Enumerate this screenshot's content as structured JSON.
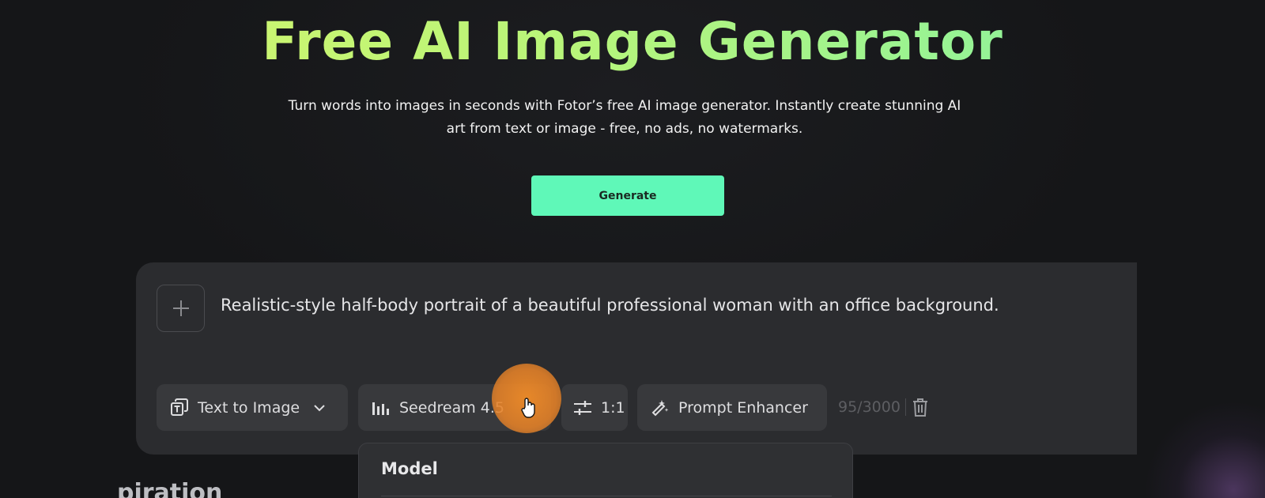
{
  "hero": {
    "title": "Free AI Image Generator",
    "subtitle_line1": "Turn words into images in seconds with Fotor’s free AI image generator. Instantly create stunning AI",
    "subtitle_line2": "art from text or image - free, no ads, no watermarks.",
    "generate_label": "Generate"
  },
  "prompt": {
    "text": "Realistic-style half-body portrait of a beautiful professional woman with an office background."
  },
  "toolbar": {
    "mode_label": "Text to Image",
    "model_label": "Seedream 4.5",
    "ratio_label": "1:1",
    "enhancer_label": "Prompt Enhancer",
    "counter": "95/3000"
  },
  "dropdown": {
    "title": "Model"
  },
  "section": {
    "partial_heading": "piration"
  },
  "colors": {
    "accent": "#5ff8b8",
    "title_gradient_start": "#d8f56a",
    "title_gradient_end": "#7ff2a8",
    "cursor_halo": "#f08c28"
  },
  "icons": {
    "add": "plus-icon",
    "mode": "text-image-icon",
    "mode_chevron": "chevron-down-icon",
    "model": "bars-icon",
    "ratio": "sliders-icon",
    "enhancer": "magic-wand-icon",
    "clear": "trash-icon",
    "cursor": "hand-cursor-icon"
  }
}
